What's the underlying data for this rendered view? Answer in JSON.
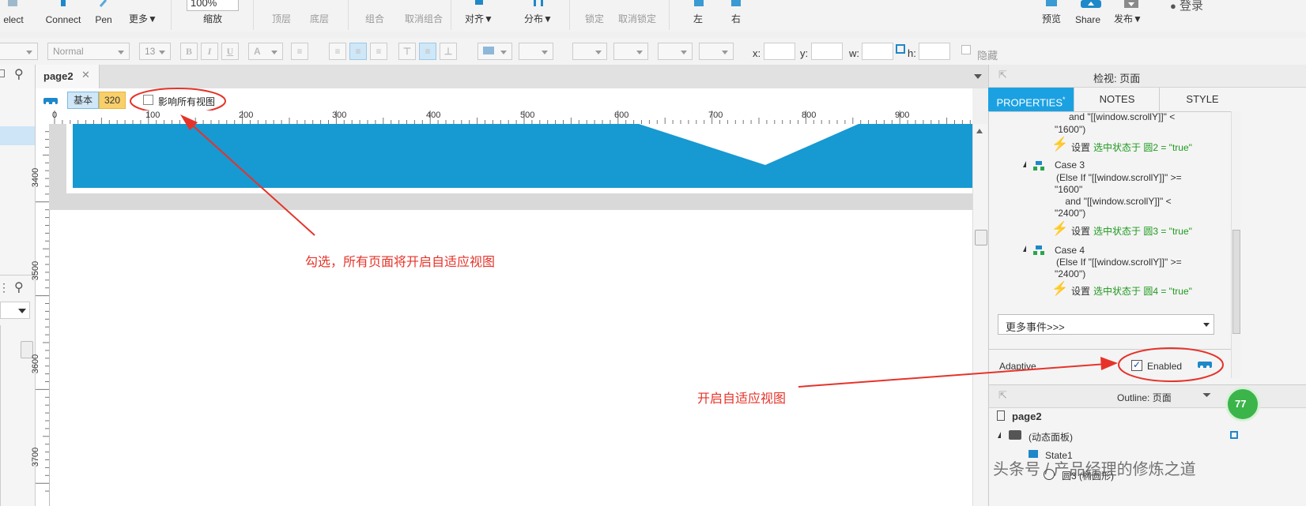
{
  "toolbar1": {
    "select": "elect",
    "connect": "Connect",
    "pen": "Pen",
    "more": "更多▼",
    "zoom_value": "100%",
    "zoom_label": "缩放",
    "top_layer": "顶层",
    "bottom_layer": "底层",
    "group": "组合",
    "ungroup": "取消组合",
    "align": "对齐▼",
    "distribute": "分布▼",
    "lock": "锁定",
    "unlock": "取消锁定",
    "left": "左",
    "right": "右",
    "preview": "预览",
    "share": "Share",
    "publish": "发布▼",
    "login": "登录"
  },
  "toolbar2": {
    "style_value": "Normal",
    "font_size": "13",
    "bold": "B",
    "italic": "I",
    "underline": "U",
    "font_color": "A",
    "x_label": "x:",
    "y_label": "y:",
    "w_label": "w:",
    "h_label": "h:",
    "hidden_label": "隐藏"
  },
  "tabs": [
    {
      "label": "page2"
    }
  ],
  "adaptive_bar": {
    "base": "基本",
    "width_320": "320",
    "affect_all_label": "影响所有视图"
  },
  "ruler": {
    "h_ticks": [
      "0",
      "100",
      "200",
      "300",
      "400",
      "500",
      "600",
      "700",
      "800",
      "900"
    ],
    "v_ticks": [
      "3400",
      "3500",
      "3600",
      "3700"
    ]
  },
  "inspect": {
    "title": "检视: 页面",
    "tabs": [
      "PROPERTIES",
      "NOTES",
      "STYLE"
    ],
    "event_lines": [
      "and \"[[window.scrollY]]\" <",
      "\"1600\")"
    ],
    "cases": [
      {
        "set_text": "设置",
        "action": "选中状态于 圆2 = \"true\""
      },
      {
        "name": "Case 3",
        "cond": [
          "(Else If \"[[window.scrollY]]\" >=",
          "\"1600\"",
          "    and \"[[window.scrollY]]\" <",
          "\"2400\")"
        ],
        "set_text": "设置",
        "action": "选中状态于 圆3 = \"true\""
      },
      {
        "name": "Case 4",
        "cond": [
          "(Else If \"[[window.scrollY]]\" >=",
          "\"2400\")"
        ],
        "set_text": "设置",
        "action": "选中状态于 圆4 = \"true\""
      }
    ],
    "more_events": "更多事件>>>",
    "adaptive_label": "Adaptive",
    "enabled_label": "Enabled"
  },
  "outline": {
    "title": "Outline: 页面",
    "items": [
      "page2",
      "(动态面板)",
      "State1",
      "圆3 (椭圆形)"
    ]
  },
  "annotations": {
    "check_note": "勾选，所有页面将开启自适应视图",
    "enable_note": "开启自适应视图",
    "badge": "77"
  },
  "watermark": "头条号 / 产品经理的修炼之道",
  "colors": {
    "banner": "#1799d2",
    "accent": "#1ba1e2",
    "annotation": "#e6332a"
  }
}
